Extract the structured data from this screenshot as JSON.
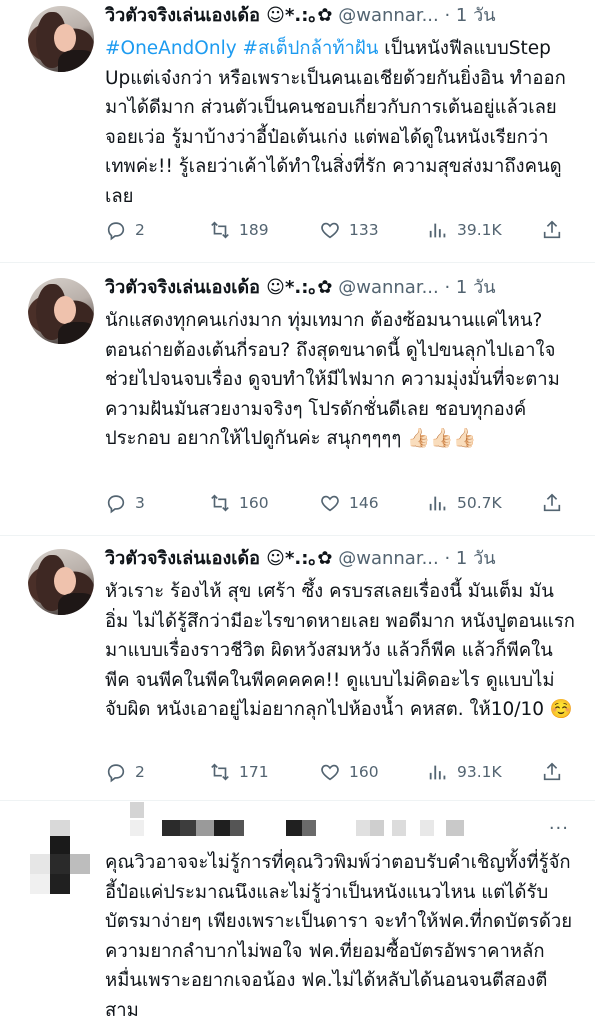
{
  "tweets": [
    {
      "display_name": "วิวตัวจริงเล่นเองเด้อ ☺︎*.:｡✿",
      "handle": "@wannar...",
      "time": "· 1 วัน",
      "hashtags": "#OneAndOnly #สเต็ปกล้าท้าฝัน",
      "text": " เป็นหนังฟีลแบบStep Upแต่เจ๋งกว่า หรือเพราะเป็นคนเอเชียด้วยกันยิ่งอิน ทำออกมาได้ดีมาก ส่วนตัวเป็นคนชอบเกี่ยวกับการเต้นอยู่แล้วเลยจอยเว่อ รู้มาบ้างว่าอี้ป๋อเต้นเก่ง แต่พอได้ดูในหนังเรียกว่าเทพค่ะ!! รู้เลยว่าเค้าได้ทำในสิ่งที่รัก ความสุขส่งมาถึงคนดูเลย",
      "replies": "2",
      "retweets": "189",
      "likes": "133",
      "views": "39.1K"
    },
    {
      "display_name": "วิวตัวจริงเล่นเองเด้อ ☺︎*.:｡✿",
      "handle": "@wannar...",
      "time": "· 1 วัน",
      "hashtags": "",
      "text": "นักแสดงทุกคนเก่งมาก ทุ่มเทมาก ต้องซ้อมนานแค่ไหน? ตอนถ่ายต้องเต้นกี่รอบ? ถึงสุดขนาดนี้ ดูไปขนลุกไปเอาใจช่วยไปจนจบเรื่อง ดูจบทำให้มีไฟมาก ความมุ่งมั่นที่จะตามความฝันมันสวยงามจริงๆ โปรดักชั่นดีเลย ชอบทุกองค์ประกอบ อยากให้ไปดูกันค่ะ สนุกๆๆๆๆ 👍🏻👍🏻👍🏻",
      "replies": "3",
      "retweets": "160",
      "likes": "146",
      "views": "50.7K"
    },
    {
      "display_name": "วิวตัวจริงเล่นเองเด้อ ☺︎*.:｡✿",
      "handle": "@wannar...",
      "time": "· 1 วัน",
      "hashtags": "",
      "text": "หัวเราะ ร้องไห้ สุข เศร้า ซึ้ง ครบรสเลยเรื่องนี้ มันเต็ม มันอิ่ม ไม่ได้รู้สึกว่ามีอะไรขาดหายเลย พอดีมาก หนังปูตอนแรกมาแบบเรื่องราวชีวิต ผิดหวังสมหวัง แล้วก็พีค แล้วก็พีคในพีค จนพีคในพีคในพีคคคคค!! ดูแบบไม่คิดอะไร ดูแบบไม่จับผิด หนังเอาอยู่ไม่อยากลุกไปห้องน้ำ คหสต. ให้10/10 ☺️",
      "replies": "2",
      "retweets": "171",
      "likes": "160",
      "views": "93.1K"
    }
  ],
  "reply": {
    "more": "···",
    "text": "คุณวิวอาจจะไม่รู้การที่คุณวิวพิมพ์ว่าตอบรับคำเชิญทั้งที่รู้จักอี้ป๋อแค่ประมาณนึงและไม่รู้ว่าเป็นหนังแนวไหน แต่ได้รับบัตรมาง่ายๆ เพียงเพราะเป็นดารา จะทำให้ฟค.ที่กดบัตรด้วยความยากลำบากไม่พอใจ ฟค.ที่ยอมซื้อบัตรอัพราคาหลักหมื่นเพราะอยากเจอน้อง ฟค.ไม่ได้หลับได้นอนจนตีสองตีสาม"
  },
  "colors": {
    "link": "#1d9bf0",
    "meta": "#536471",
    "text": "#0f1419"
  },
  "icons": [
    "reply-icon",
    "retweet-icon",
    "like-icon",
    "views-icon",
    "share-icon"
  ]
}
